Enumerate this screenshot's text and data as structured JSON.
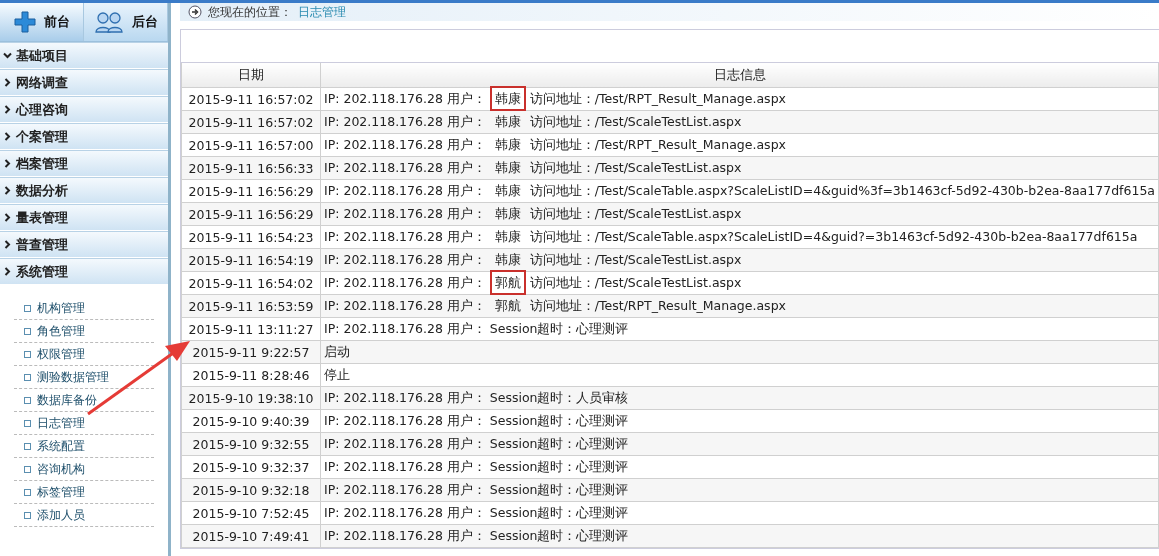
{
  "top_tabs": [
    {
      "label": "前台",
      "kind": "plus",
      "selected": true
    },
    {
      "label": "后台",
      "kind": "users",
      "selected": false
    }
  ],
  "sidebar": {
    "items": [
      {
        "label": "基础项目",
        "expanded": true
      },
      {
        "label": "网络调查",
        "expanded": false
      },
      {
        "label": "心理咨询",
        "expanded": false
      },
      {
        "label": "个案管理",
        "expanded": false
      },
      {
        "label": "档案管理",
        "expanded": false
      },
      {
        "label": "数据分析",
        "expanded": false
      },
      {
        "label": "量表管理",
        "expanded": false
      },
      {
        "label": "普查管理",
        "expanded": false
      },
      {
        "label": "系统管理",
        "expanded": false
      }
    ],
    "sub_items": [
      "机构管理",
      "角色管理",
      "权限管理",
      "测验数据管理",
      "数据库备份",
      "日志管理",
      "系统配置",
      "咨询机构",
      "标签管理",
      "添加人员"
    ]
  },
  "breadcrumb": {
    "label": "您现在的位置：",
    "current": "日志管理"
  },
  "table": {
    "columns": [
      "日期",
      "日志信息"
    ],
    "rows": [
      {
        "date": "2015-9-11 16:57:02",
        "info": "IP: 202.118.176.28 用户：",
        "user": "韩康",
        "detail": "访问地址：/Test/RPT_Result_Manage.aspx",
        "marked": true
      },
      {
        "date": "2015-9-11 16:57:02",
        "info": "IP: 202.118.176.28 用户：",
        "user": "韩康",
        "detail": "访问地址：/Test/ScaleTestList.aspx",
        "marked": false
      },
      {
        "date": "2015-9-11 16:57:00",
        "info": "IP: 202.118.176.28 用户：",
        "user": "韩康",
        "detail": "访问地址：/Test/RPT_Result_Manage.aspx",
        "marked": false
      },
      {
        "date": "2015-9-11 16:56:33",
        "info": "IP: 202.118.176.28 用户：",
        "user": "韩康",
        "detail": "访问地址：/Test/ScaleTestList.aspx",
        "marked": false
      },
      {
        "date": "2015-9-11 16:56:29",
        "info": "IP: 202.118.176.28 用户：",
        "user": "韩康",
        "detail": "访问地址：/Test/ScaleTable.aspx?ScaleListID=4&guid%3f=3b1463cf-5d92-430b-b2ea-8aa177df615a",
        "marked": false
      },
      {
        "date": "2015-9-11 16:56:29",
        "info": "IP: 202.118.176.28 用户：",
        "user": "韩康",
        "detail": "访问地址：/Test/ScaleTestList.aspx",
        "marked": false
      },
      {
        "date": "2015-9-11 16:54:23",
        "info": "IP: 202.118.176.28 用户：",
        "user": "韩康",
        "detail": "访问地址：/Test/ScaleTable.aspx?ScaleListID=4&guid?=3b1463cf-5d92-430b-b2ea-8aa177df615a",
        "marked": false
      },
      {
        "date": "2015-9-11 16:54:19",
        "info": "IP: 202.118.176.28 用户：",
        "user": "韩康",
        "detail": "访问地址：/Test/ScaleTestList.aspx",
        "marked": false
      },
      {
        "date": "2015-9-11 16:54:02",
        "info": "IP: 202.118.176.28 用户：",
        "user": "郭航",
        "detail": "访问地址：/Test/ScaleTestList.aspx",
        "marked": true
      },
      {
        "date": "2015-9-11 16:53:59",
        "info": "IP: 202.118.176.28 用户：",
        "user": "郭航",
        "detail": "访问地址：/Test/RPT_Result_Manage.aspx",
        "marked": false
      },
      {
        "date": "2015-9-11 13:11:27",
        "info": "IP: 202.118.176.28 用户： Session超时：心理测评"
      },
      {
        "date": "2015-9-11 9:22:57",
        "info": "启动"
      },
      {
        "date": "2015-9-11 8:28:46",
        "info": "停止"
      },
      {
        "date": "2015-9-10 19:38:10",
        "info": "IP: 202.118.176.28 用户： Session超时：人员审核"
      },
      {
        "date": "2015-9-10 9:40:39",
        "info": "IP: 202.118.176.28 用户： Session超时：心理测评"
      },
      {
        "date": "2015-9-10 9:32:55",
        "info": "IP: 202.118.176.28 用户： Session超时：心理测评"
      },
      {
        "date": "2015-9-10 9:32:37",
        "info": "IP: 202.118.176.28 用户： Session超时：心理测评"
      },
      {
        "date": "2015-9-10 9:32:18",
        "info": "IP: 202.118.176.28 用户： Session超时：心理测评"
      },
      {
        "date": "2015-9-10 7:52:45",
        "info": "IP: 202.118.176.28 用户： Session超时：心理测评"
      },
      {
        "date": "2015-9-10 7:49:41",
        "info": "IP: 202.118.176.28 用户： Session超时：心理测评"
      }
    ]
  }
}
